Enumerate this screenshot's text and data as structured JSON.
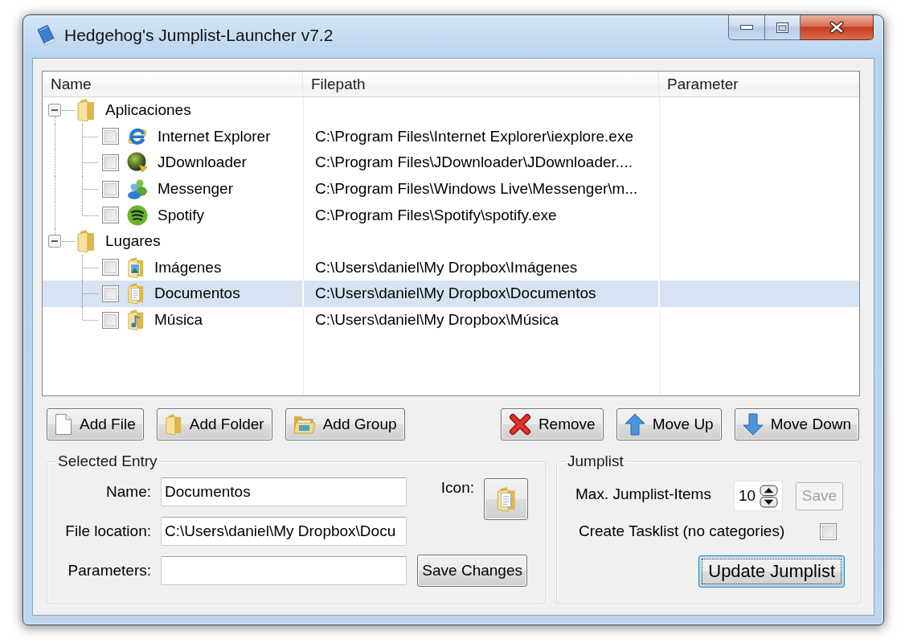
{
  "window": {
    "title": "Hedgehog's Jumplist-Launcher v7.2"
  },
  "tree": {
    "columns": [
      "Name",
      "Filepath",
      "Parameter"
    ],
    "items": [
      {
        "name": "Aplicaciones",
        "expanded": true,
        "selected": false,
        "children": [
          {
            "name": "Internet Explorer",
            "filepath": "C:\\Program Files\\Internet Explorer\\iexplore.exe",
            "checked": false,
            "selected": false
          },
          {
            "name": "JDownloader",
            "filepath": "C:\\Program Files\\JDownloader\\JDownloader....",
            "checked": false,
            "selected": false
          },
          {
            "name": "Messenger",
            "filepath": "C:\\Program Files\\Windows Live\\Messenger\\m...",
            "checked": false,
            "selected": false
          },
          {
            "name": "Spotify",
            "filepath": "C:\\Program Files\\Spotify\\spotify.exe",
            "checked": false,
            "selected": false
          }
        ]
      },
      {
        "name": "Lugares",
        "expanded": true,
        "selected": false,
        "children": [
          {
            "name": "Imágenes",
            "filepath": "C:\\Users\\daniel\\My Dropbox\\Imágenes",
            "checked": false,
            "selected": false
          },
          {
            "name": "Documentos",
            "filepath": "C:\\Users\\daniel\\My Dropbox\\Documentos",
            "checked": false,
            "selected": true
          },
          {
            "name": "Música",
            "filepath": "C:\\Users\\daniel\\My Dropbox\\Música",
            "checked": false,
            "selected": false
          }
        ]
      }
    ]
  },
  "add_buttons": [
    "Add File",
    "Add Folder",
    "Add Group"
  ],
  "edit_buttons": [
    "Remove",
    "Move Up",
    "Move Down"
  ],
  "selected_entry": {
    "title": "Selected Entry",
    "fields": [
      {
        "label": "Name:",
        "value": "Documentos"
      },
      {
        "label": "File location:",
        "value": "C:\\Users\\daniel\\My Dropbox\\Docu"
      },
      {
        "label": "Parameters:"
      }
    ],
    "icon_label": "Icon:",
    "save_button": "Save Changes"
  },
  "jumplist": {
    "title": "Jumplist",
    "max_items": {
      "label": "Max. Jumplist-Items",
      "value": "10"
    },
    "save_button": {
      "label": "Save",
      "disabled": true
    },
    "tasklist": {
      "label": "Create Tasklist (no categories)",
      "checked": false
    },
    "update_button": {
      "label": "Update Jumplist",
      "focused": true
    }
  }
}
